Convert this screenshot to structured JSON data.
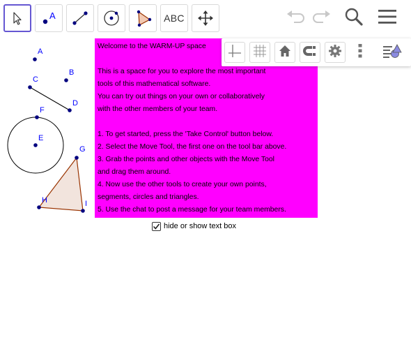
{
  "toolbar": {
    "tools": [
      {
        "name": "move-tool",
        "icon": "cursor-arrow-icon",
        "active": true
      },
      {
        "name": "point-tool",
        "icon": "point-icon",
        "label": "A"
      },
      {
        "name": "segment-tool",
        "icon": "segment-icon"
      },
      {
        "name": "circle-tool",
        "icon": "circle-center-icon"
      },
      {
        "name": "polygon-tool",
        "icon": "polygon-icon"
      },
      {
        "name": "text-tool",
        "icon": "text-abc-icon",
        "label": "ABC"
      },
      {
        "name": "move-graphics-view-tool",
        "icon": "move-arrows-icon"
      }
    ],
    "actions": [
      "undo-icon",
      "redo-icon",
      "search-icon",
      "menu-icon"
    ]
  },
  "stylebar": {
    "buttons": [
      "axes-icon",
      "grid-icon",
      "home-icon",
      "magnet-icon",
      "settings-gear-icon",
      "more-vertical-icon",
      "algebra-view-toggle-icon"
    ]
  },
  "geometry": {
    "points": {
      "A": "A",
      "B": "B",
      "C": "C",
      "D": "D",
      "E": "E",
      "F": "F",
      "G": "G",
      "H": "H",
      "I": "I"
    },
    "colors": {
      "point": "#00007f",
      "label": "#0000ff",
      "polygon_fill": "#f2e4dd",
      "polygon_stroke": "#993300",
      "circle_stroke": "#000000",
      "segment_stroke": "#000000"
    }
  },
  "textbox": {
    "background": "#ff00ff",
    "lines": [
      "Welcome to the WARM-UP space",
      "",
      "This is a space for you to explore the most important",
      "tools of this mathematical software.",
      "You can try out things on your own or collaboratively",
      "with the other members of your team.",
      "",
      "1. To get started, press the 'Take Control' button below.",
      "2. Select the Move Tool, the first one on the tool bar above.",
      "3. Grab the points and other objects with the Move Tool",
      "and drag them around.",
      "4. Now use the other tools to create your own points,",
      "segments, circles and triangles.",
      "5. Use the chat to post a message for your team members."
    ]
  },
  "checkbox": {
    "label": "hide or show text box",
    "checked": true
  },
  "accent_color": "#6557d2"
}
